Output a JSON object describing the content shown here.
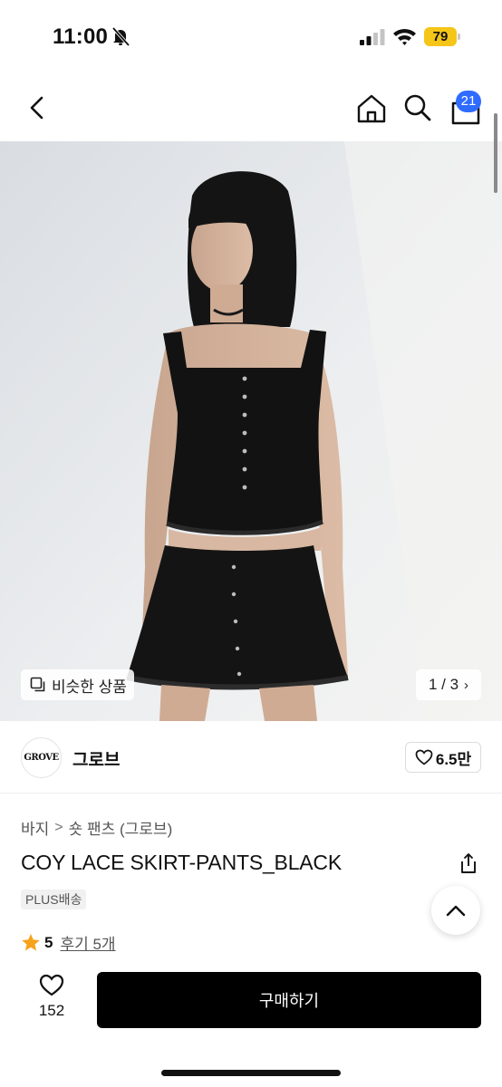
{
  "status_bar": {
    "time": "11:00",
    "battery_level": "79",
    "icons": [
      "bell-slash-icon",
      "signal-icon",
      "wifi-icon",
      "battery-icon"
    ]
  },
  "nav": {
    "icons": [
      "chevron-left-icon",
      "home-icon",
      "search-icon",
      "shopping-bag-icon"
    ],
    "cart_count": "21"
  },
  "gallery": {
    "similar_label": "비슷한 상품",
    "page_counter": "1 / 3",
    "current_page": 1,
    "total_pages": 3
  },
  "brand": {
    "logo_text": "GROVE",
    "name": "그로브",
    "likes": "6.5만"
  },
  "product": {
    "breadcrumb": [
      "바지",
      "숏 팬츠 (그로브)"
    ],
    "title": "COY LACE SKIRT-PANTS_BLACK",
    "delivery_badge": "PLUS배송",
    "rating": "5",
    "review_label": "후기 5개"
  },
  "bottom_bar": {
    "wish_count": "152",
    "buy_label": "구매하기"
  },
  "colors": {
    "accent_blue": "#2f6bff",
    "battery_yellow": "#f5c518",
    "star": "#f7a21b",
    "button_black": "#000000"
  }
}
